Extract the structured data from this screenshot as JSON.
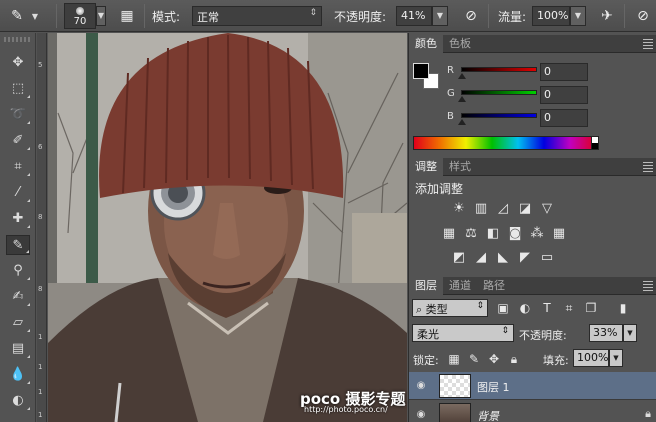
{
  "options_bar": {
    "brush_size": "70",
    "mode_label": "模式:",
    "mode_value": "正常",
    "opacity_label": "不透明度:",
    "opacity_value": "41%",
    "flow_label": "流量:",
    "flow_value": "100%"
  },
  "ruler": [
    "5",
    "6",
    "8",
    "8",
    "1",
    "1",
    "1",
    "1"
  ],
  "color_panel": {
    "tabs": [
      "颜色",
      "色板"
    ],
    "channels": [
      {
        "label": "R",
        "value": "0"
      },
      {
        "label": "G",
        "value": "0"
      },
      {
        "label": "B",
        "value": "0"
      }
    ],
    "foreground": "#000000",
    "background": "#ffffff"
  },
  "adjustments_panel": {
    "tabs": [
      "调整",
      "样式"
    ],
    "title": "添加调整"
  },
  "layers_panel": {
    "tabs": [
      "图层",
      "通道",
      "路径"
    ],
    "filter_value": "类型",
    "blend_mode": "柔光",
    "opacity_label": "不透明度:",
    "opacity_value": "33%",
    "lock_label": "锁定:",
    "fill_label": "填充:",
    "fill_value": "100%",
    "layers": [
      {
        "name": "图层 1",
        "selected": true
      },
      {
        "name": "背景",
        "selected": false
      }
    ]
  },
  "watermark": {
    "brand": "poco 摄影专题",
    "url": "http://photo.poco.cn/"
  }
}
